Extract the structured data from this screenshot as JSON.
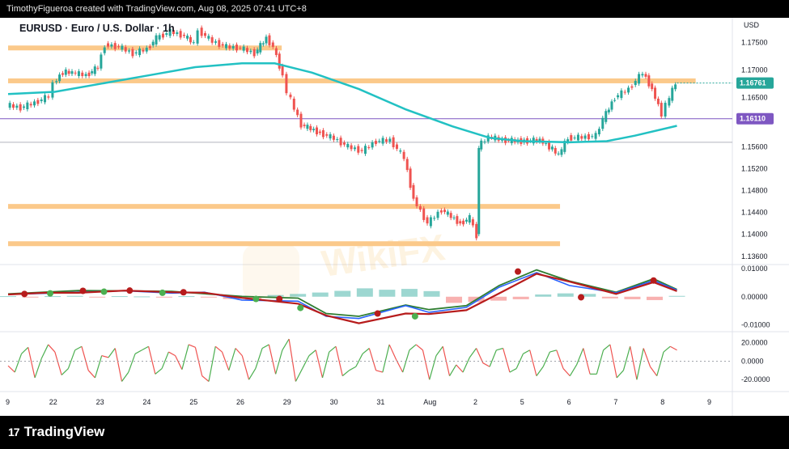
{
  "header": {
    "caption": "TimothyFigueroa created with TradingView.com, Aug 08, 2025 07:41 UTC+8"
  },
  "footer": {
    "brand": "TradingView",
    "logo_mark": "17"
  },
  "colors": {
    "up": "#26a69a",
    "down": "#ef5350",
    "ma": "#22c1c3",
    "zone": "#fbc98a",
    "hline": "#7e57c2",
    "macd_fast": "#2962ff",
    "macd_slow": "#b71c1c",
    "macd_envelope": "#2e7d32",
    "rsi_up": "#4caf50",
    "rsi_down": "#ef5350",
    "label_bg": "#131722",
    "watermark": "#f5a623"
  },
  "watermark_text": "WikiFX",
  "chart_data": [
    {
      "type": "line",
      "title": "EURUSD · Euro / U.S. Dollar · 1h",
      "currency": "USD",
      "y_ticks": [
        "1.17500",
        "1.17000",
        "1.16500",
        "1.15600",
        "1.15200",
        "1.14800",
        "1.14400",
        "1.14000",
        "1.13600"
      ],
      "x_ticks": [
        "9",
        "22",
        "23",
        "24",
        "25",
        "26",
        "29",
        "30",
        "31",
        "Aug",
        "2",
        "5",
        "6",
        "7",
        "8",
        "9"
      ],
      "current_price_label": "1.16761",
      "horizontal_line_label": "1.16110",
      "ylim": [
        1.1345,
        1.1795
      ],
      "price_path": [
        [
          0,
          1.1636
        ],
        [
          0.3,
          1.1631
        ],
        [
          0.6,
          1.164
        ],
        [
          0.9,
          1.1652
        ],
        [
          1.0,
          1.1675
        ],
        [
          1.2,
          1.1696
        ],
        [
          1.4,
          1.1695
        ],
        [
          1.7,
          1.169
        ],
        [
          1.95,
          1.1705
        ],
        [
          2.1,
          1.1746
        ],
        [
          2.4,
          1.1742
        ],
        [
          2.7,
          1.173
        ],
        [
          3.0,
          1.1738
        ],
        [
          3.2,
          1.1758
        ],
        [
          3.5,
          1.177
        ],
        [
          3.8,
          1.1762
        ],
        [
          4.0,
          1.1748
        ],
        [
          4.1,
          1.1772
        ],
        [
          4.4,
          1.1752
        ],
        [
          4.7,
          1.1742
        ],
        [
          5.0,
          1.174
        ],
        [
          5.3,
          1.173
        ],
        [
          5.55,
          1.1758
        ],
        [
          5.7,
          1.1742
        ],
        [
          5.9,
          1.169
        ],
        [
          6.0,
          1.166
        ],
        [
          6.3,
          1.16
        ],
        [
          6.7,
          1.1585
        ],
        [
          7.0,
          1.1575
        ],
        [
          7.3,
          1.156
        ],
        [
          7.6,
          1.1552
        ],
        [
          7.9,
          1.157
        ],
        [
          8.2,
          1.1572
        ],
        [
          8.5,
          1.154
        ],
        [
          8.7,
          1.1465
        ],
        [
          9.0,
          1.142
        ],
        [
          9.3,
          1.1445
        ],
        [
          9.7,
          1.142
        ],
        [
          9.9,
          1.143
        ],
        [
          10.05,
          1.1398
        ],
        [
          10.08,
          1.156
        ],
        [
          10.3,
          1.1578
        ],
        [
          10.6,
          1.1572
        ],
        [
          11.0,
          1.157
        ],
        [
          11.4,
          1.1572
        ],
        [
          11.6,
          1.156
        ],
        [
          11.8,
          1.1545
        ],
        [
          12.0,
          1.1576
        ],
        [
          12.3,
          1.1577
        ],
        [
          12.6,
          1.158
        ],
        [
          12.75,
          1.161
        ],
        [
          13.0,
          1.165
        ],
        [
          13.3,
          1.1665
        ],
        [
          13.6,
          1.1695
        ],
        [
          13.8,
          1.1665
        ],
        [
          14.0,
          1.162
        ],
        [
          14.1,
          1.1635
        ],
        [
          14.3,
          1.1676
        ]
      ],
      "moving_average_path": [
        [
          0,
          1.1656
        ],
        [
          1.0,
          1.166
        ],
        [
          2.0,
          1.1675
        ],
        [
          3.0,
          1.169
        ],
        [
          4.0,
          1.1705
        ],
        [
          5.0,
          1.1712
        ],
        [
          5.7,
          1.1712
        ],
        [
          6.5,
          1.1695
        ],
        [
          7.5,
          1.1665
        ],
        [
          8.5,
          1.1628
        ],
        [
          9.5,
          1.1597
        ],
        [
          10.3,
          1.1576
        ],
        [
          11.0,
          1.157
        ],
        [
          12.0,
          1.1568
        ],
        [
          12.8,
          1.157
        ],
        [
          13.4,
          1.158
        ],
        [
          14.3,
          1.1598
        ]
      ],
      "support_resistance_zones": [
        {
          "from": 0,
          "to": 5.85,
          "level": 1.174
        },
        {
          "from": 0,
          "to": 14.7,
          "level": 1.168
        },
        {
          "from": 0,
          "to": 11.8,
          "level": 1.1451
        },
        {
          "from": 0,
          "to": 11.8,
          "level": 1.1383
        }
      ],
      "horizontal_line": 1.1611,
      "gray_level": 1.1568
    },
    {
      "type": "line",
      "name": "MACD",
      "y_ticks": [
        "0.01000",
        "0.00000",
        "-0.01000"
      ],
      "ylim": [
        -0.0125,
        0.0115
      ],
      "fast": [
        [
          0,
          0.0008
        ],
        [
          0.8,
          0.0012
        ],
        [
          1.5,
          0.0016
        ],
        [
          2.5,
          0.0021
        ],
        [
          3.5,
          0.0013
        ],
        [
          4.2,
          0.0016
        ],
        [
          5.0,
          -0.0012
        ],
        [
          6.2,
          -0.0016
        ],
        [
          6.8,
          -0.007
        ],
        [
          7.5,
          -0.0078
        ],
        [
          8.5,
          -0.0032
        ],
        [
          9.0,
          -0.0056
        ],
        [
          9.8,
          -0.0038
        ],
        [
          10.5,
          0.0034
        ],
        [
          11.3,
          0.0086
        ],
        [
          12.0,
          0.004
        ],
        [
          13.0,
          0.0014
        ],
        [
          13.8,
          0.0058
        ],
        [
          14.3,
          0.0024
        ]
      ],
      "slow": [
        [
          0,
          0.0008
        ],
        [
          0.8,
          0.0014
        ],
        [
          1.5,
          0.0014
        ],
        [
          2.5,
          0.0022
        ],
        [
          3.5,
          0.0016
        ],
        [
          4.2,
          0.0014
        ],
        [
          5.0,
          -0.0004
        ],
        [
          6.2,
          -0.0025
        ],
        [
          6.8,
          -0.0067
        ],
        [
          7.5,
          -0.0095
        ],
        [
          8.5,
          -0.006
        ],
        [
          9.0,
          -0.0062
        ],
        [
          9.8,
          -0.0048
        ],
        [
          10.5,
          0.0012
        ],
        [
          11.3,
          0.0082
        ],
        [
          12.0,
          0.0054
        ],
        [
          13.0,
          0.001
        ],
        [
          13.8,
          0.0052
        ],
        [
          14.3,
          0.002
        ]
      ],
      "envelope": [
        [
          0,
          0.001
        ],
        [
          1.5,
          0.0022
        ],
        [
          2.5,
          0.0021
        ],
        [
          3.5,
          0.0019
        ],
        [
          5.0,
          0.0001
        ],
        [
          6.2,
          -0.0005
        ],
        [
          6.8,
          -0.006
        ],
        [
          7.5,
          -0.007
        ],
        [
          8.5,
          -0.003
        ],
        [
          9.0,
          -0.0046
        ],
        [
          9.8,
          -0.0032
        ],
        [
          10.5,
          0.004
        ],
        [
          11.3,
          0.0096
        ],
        [
          12.0,
          0.0056
        ],
        [
          13.0,
          0.0016
        ],
        [
          13.8,
          0.0064
        ],
        [
          14.3,
          0.0026
        ]
      ],
      "crosses": [
        {
          "x": 0.35,
          "y": 0.001,
          "c": "down"
        },
        {
          "x": 0.9,
          "y": 0.0012,
          "c": "up"
        },
        {
          "x": 1.6,
          "y": 0.0021,
          "c": "down"
        },
        {
          "x": 2.05,
          "y": 0.0018,
          "c": "up"
        },
        {
          "x": 2.6,
          "y": 0.0022,
          "c": "down"
        },
        {
          "x": 3.3,
          "y": 0.0014,
          "c": "up"
        },
        {
          "x": 3.75,
          "y": 0.0016,
          "c": "down"
        },
        {
          "x": 5.3,
          "y": -0.0008,
          "c": "up"
        },
        {
          "x": 5.8,
          "y": -0.0008,
          "c": "down"
        },
        {
          "x": 6.25,
          "y": -0.004,
          "c": "up"
        },
        {
          "x": 7.9,
          "y": -0.006,
          "c": "down"
        },
        {
          "x": 8.7,
          "y": -0.007,
          "c": "up"
        },
        {
          "x": 10.9,
          "y": 0.009,
          "c": "down"
        },
        {
          "x": 12.25,
          "y": -0.0002,
          "c": "down"
        },
        {
          "x": 13.8,
          "y": 0.0058,
          "c": "down"
        }
      ],
      "histogram": [
        0.0002,
        -0.0002,
        0.0002,
        0.0003,
        -0.0002,
        0.0002,
        0.0001,
        -0.0003,
        0.0002,
        -0.0001,
        -0.0008,
        -0.0012,
        0.0006,
        0.001,
        0.0015,
        0.0021,
        0.003,
        0.0025,
        0.0028,
        0.002,
        -0.0022,
        -0.0019,
        -0.0014,
        -0.0009,
        0.0008,
        0.0012,
        0.001,
        -0.0006,
        -0.0009,
        -0.0012,
        0.0003
      ]
    },
    {
      "type": "line",
      "name": "Oscillator",
      "y_ticks": [
        "20.0000",
        "0.0000",
        "-20.0000"
      ],
      "ylim": [
        -33,
        32
      ],
      "values": [
        -5,
        -12,
        8,
        15,
        -18,
        3,
        18,
        10,
        -15,
        -8,
        12,
        16,
        -10,
        -18,
        6,
        4,
        14,
        -22,
        -12,
        8,
        12,
        16,
        -14,
        -8,
        10,
        6,
        -9,
        18,
        15,
        -16,
        -22,
        16,
        10,
        -10,
        14,
        6,
        -20,
        -8,
        14,
        18,
        -14,
        12,
        24,
        -22,
        -8,
        6,
        12,
        -18,
        10,
        16,
        -16,
        -10,
        -6,
        8,
        14,
        -10,
        -12,
        18,
        2,
        -12,
        12,
        18,
        12,
        -20,
        6,
        16,
        -16,
        -4,
        -12,
        4,
        14,
        -2,
        -6,
        12,
        14,
        -12,
        -8,
        8,
        12,
        -16,
        -6,
        10,
        12,
        -8,
        -16,
        -4,
        14,
        -14,
        -14,
        12,
        18,
        -18,
        -10,
        16,
        -20,
        14,
        -6,
        -16,
        10,
        16,
        12
      ]
    }
  ]
}
